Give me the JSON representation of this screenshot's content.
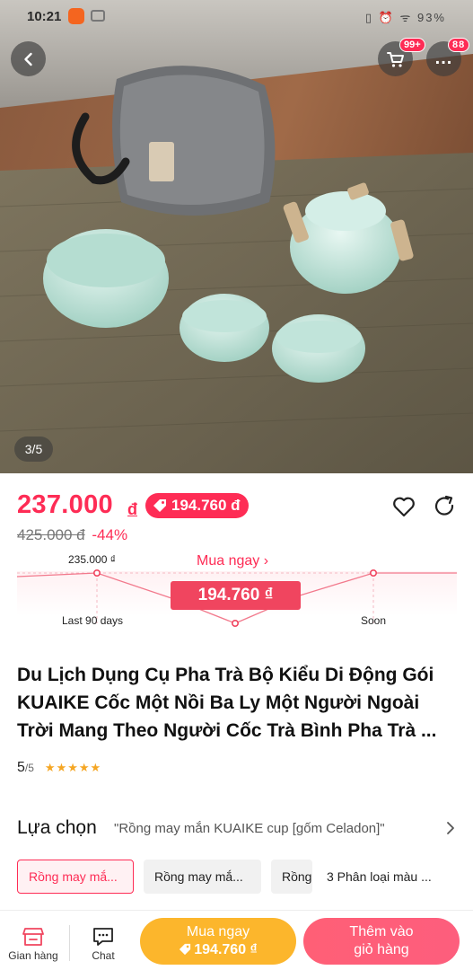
{
  "status_bar": {
    "time": "10:21",
    "right_text": "▯ ⏰ ᯤ 93%"
  },
  "gallery": {
    "counter": "3/5",
    "cart_badge": "99+",
    "more_badge": "88",
    "more_label": "..."
  },
  "price": {
    "current": "237.000",
    "currency": "đ",
    "voucher_price": "194.760 đ",
    "original": "425.000 đ",
    "discount": "-44%"
  },
  "trend": {
    "high_label": "235.000 ₫",
    "buy_now_label": "Mua ngay ›",
    "target_price": "194.760 ₫",
    "past_label": "Last 90 days",
    "future_label": "Soon"
  },
  "product": {
    "title": "Du Lịch Dụng Cụ Pha Trà Bộ Kiểu Di Động Gói KUAIKE Cốc Một Nồi Ba Ly Một Người Ngoài Trời Mang Theo Người Cốc Trà Bình Pha Trà ...",
    "rating": "5",
    "rating_max": "/5",
    "stars": "★★★★★"
  },
  "options": {
    "heading": "Lựa chọn",
    "summary": "\"Rồng may mắn KUAIKE cup [gốm Celadon]\"",
    "variants": [
      "Rồng may mắ...",
      "Rồng may mắ...",
      "Rồng"
    ],
    "count_label": "3 Phân loại màu ..."
  },
  "bottom_bar": {
    "shop_label": "Gian hàng",
    "chat_label": "Chat",
    "buy_now": "Mua ngay",
    "buy_now_price": "194.760 ₫",
    "add_to_cart_line1": "Thêm vào",
    "add_to_cart_line2": "giỏ hàng"
  },
  "colors": {
    "accent": "#fe2c55",
    "buy_now": "#fcb62c",
    "star": "#f5a623"
  }
}
